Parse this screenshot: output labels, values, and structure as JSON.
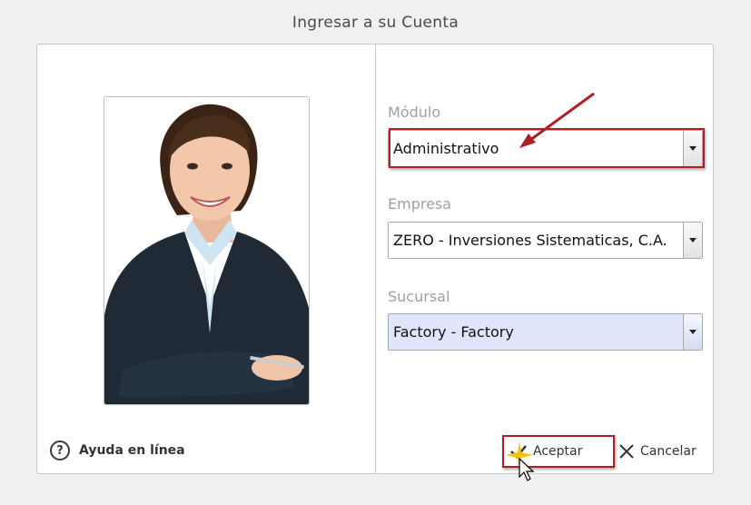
{
  "dialog": {
    "title": "Ingresar a su Cuenta"
  },
  "help": {
    "label": "Ayuda en línea",
    "icon": "question-circle-icon"
  },
  "fields": {
    "modulo": {
      "label": "Módulo",
      "value": "Administrativo"
    },
    "empresa": {
      "label": "Empresa",
      "value": "ZERO - Inversiones Sistematicas, C.A."
    },
    "sucursal": {
      "label": "Sucursal",
      "value": "Factory - Factory"
    }
  },
  "buttons": {
    "accept": {
      "label": "Aceptar",
      "icon": "check-icon"
    },
    "cancel": {
      "label": "Cancelar",
      "icon": "close-icon"
    }
  },
  "colors": {
    "annotation": "#b01e24",
    "active_select": "#dfe5fb",
    "label_gray": "#a0a0a0"
  }
}
